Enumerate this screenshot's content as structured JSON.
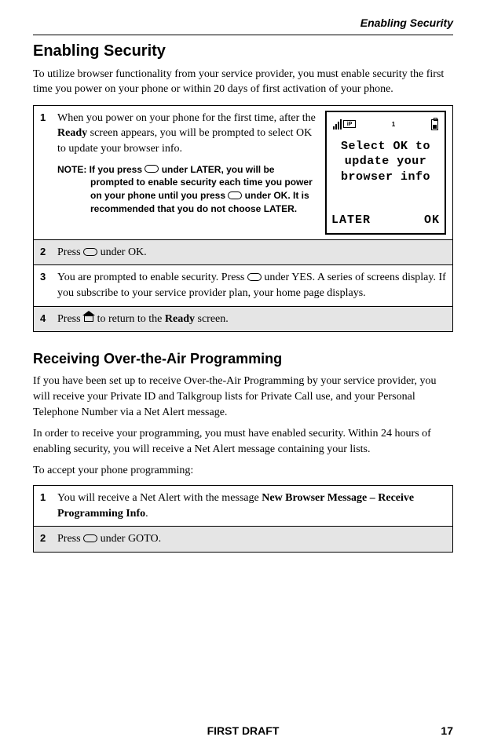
{
  "header": {
    "section_title": "Enabling Security"
  },
  "section1": {
    "heading": "Enabling Security",
    "intro": "To utilize browser functionality from your service provider, you must enable security the first time you power on your phone or within 20 days of first activation of your phone.",
    "step1": {
      "num": "1",
      "p1_a": "When you power on your phone for the first time, after the ",
      "p1_bold": "Ready",
      "p1_b": " screen appears, you will be prompted to select OK to update your browser info.",
      "note_label": "NOTE: ",
      "note_a": "If you press ",
      "note_b": " under LATER, you will be prompted to enable security each time you power on your phone until you press ",
      "note_c": " under OK. It is recommended that you do not choose LATER."
    },
    "phone": {
      "msg_l1": "Select OK to",
      "msg_l2": "update your",
      "msg_l3": "browser info",
      "sk_left": "LATER",
      "sk_right": "OK",
      "status_one": "1"
    },
    "step2": {
      "num": "2",
      "a": "Press ",
      "b": " under OK."
    },
    "step3": {
      "num": "3",
      "a": "You are prompted to enable security. Press ",
      "b": " under YES. A series of screens display. If you subscribe to your service provider plan, your home page displays."
    },
    "step4": {
      "num": "4",
      "a": "Press ",
      "b": " to return to the ",
      "bold": "Ready",
      "c": " screen."
    }
  },
  "section2": {
    "heading": "Receiving Over-the-Air Programming",
    "p1": "If you have been set up to receive Over-the-Air Programming by your service provider, you will receive your Private ID and Talkgroup lists for Private Call use, and your Personal Telephone Number via a Net Alert message.",
    "p2": "In order to receive your programming, you must have enabled security. Within 24 hours of enabling security, you will receive a Net Alert message containing your lists.",
    "p3": "To accept your phone programming:",
    "step1": {
      "num": "1",
      "a": "You will receive a Net Alert with the message ",
      "bold": "New Browser Message – Receive Programming Info",
      "b": "."
    },
    "step2": {
      "num": "2",
      "a": "Press ",
      "b": " under GOTO."
    }
  },
  "footer": {
    "center": "FIRST DRAFT",
    "page": "17"
  }
}
